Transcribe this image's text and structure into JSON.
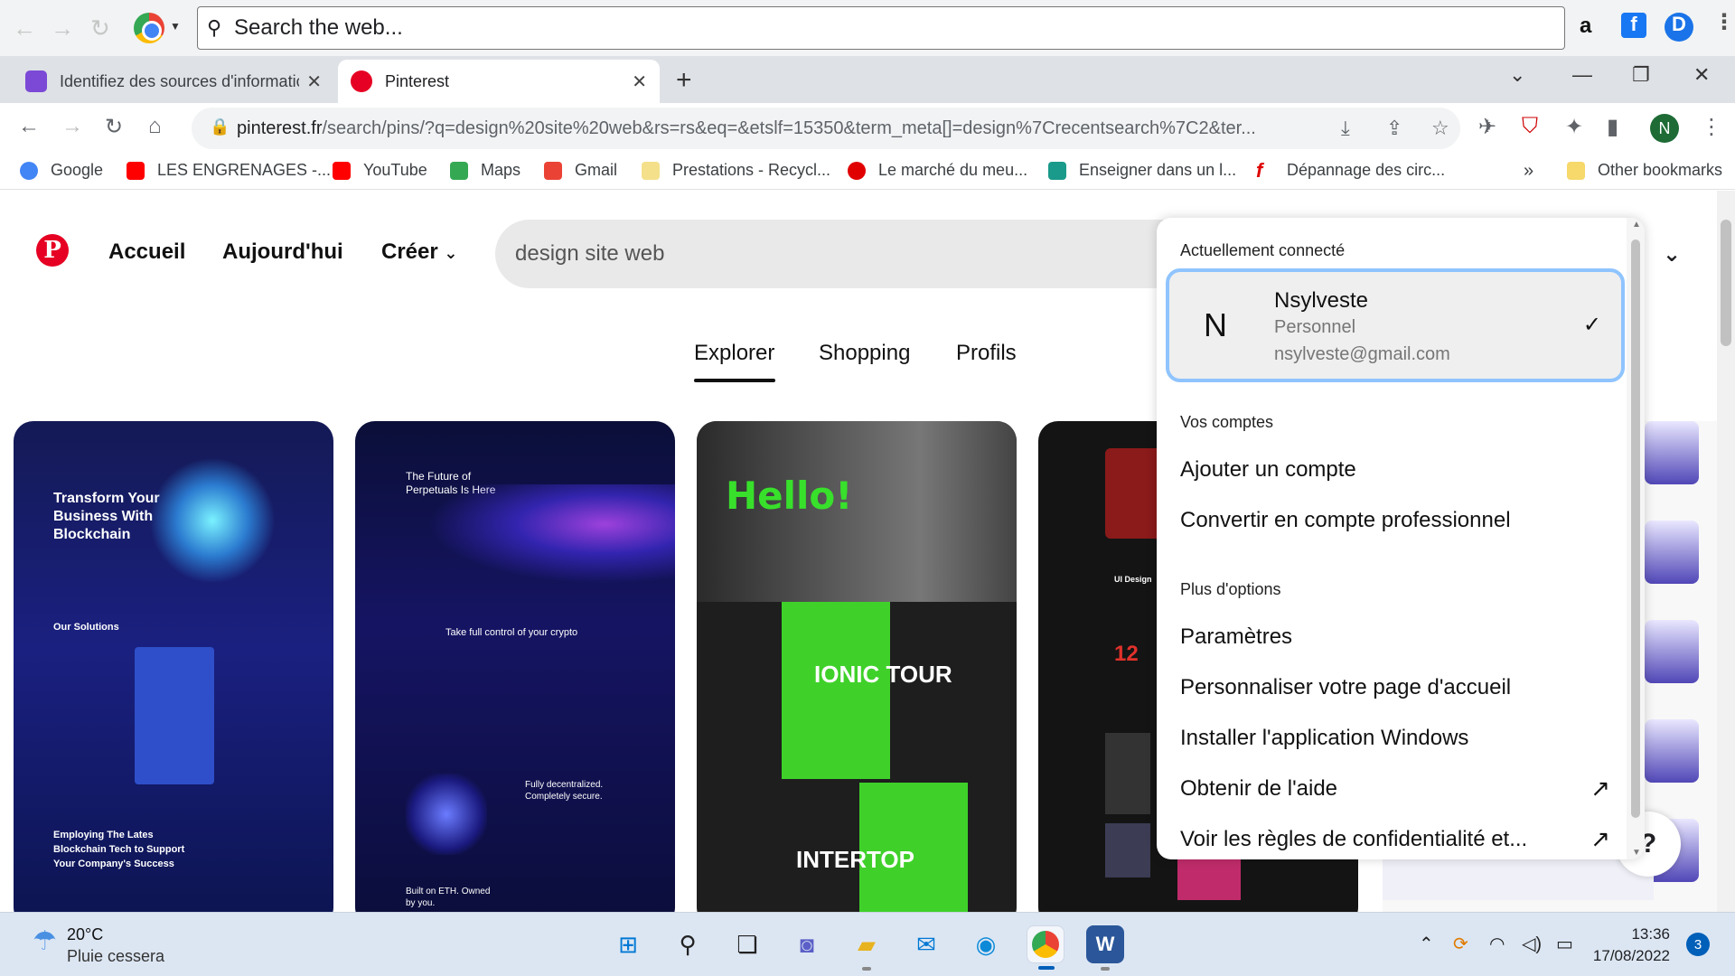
{
  "outer_search": {
    "placeholder": "Search the web..."
  },
  "tabs": [
    {
      "title": "Identifiez des sources d'information",
      "favicon_color": "#7b49d6"
    },
    {
      "title": "Pinterest",
      "favicon_color": "#e60023"
    }
  ],
  "omnibox": {
    "domain": "pinterest.fr",
    "path": "/search/pins/?q=design%20site%20web&rs=rs&eq=&etslf=15350&term_meta[]=design%7Crecentsearch%7C2&ter..."
  },
  "profile_initial": "N",
  "bookmarks": [
    {
      "label": "Google",
      "icon": "google-icon",
      "color": "#4285f4"
    },
    {
      "label": "LES ENGRENAGES -...",
      "icon": "youtube-icon",
      "color": "#ff0000"
    },
    {
      "label": "YouTube",
      "icon": "youtube-icon",
      "color": "#ff0000"
    },
    {
      "label": "Maps",
      "icon": "maps-icon",
      "color": "#34a853"
    },
    {
      "label": "Gmail",
      "icon": "gmail-icon",
      "color": "#ea4335"
    },
    {
      "label": "Prestations - Recycl...",
      "icon": "page-icon",
      "color": "#f4e08a"
    },
    {
      "label": "Le marché du meu...",
      "icon": "circle-icon",
      "color": "#e00000"
    },
    {
      "label": "Enseigner dans un l...",
      "icon": "site-icon",
      "color": "#1a9a8a"
    },
    {
      "label": "Dépannage des circ...",
      "icon": "f-icon",
      "color": "#e00000"
    }
  ],
  "bookmarks_more": "»",
  "other_bookmarks": "Other bookmarks",
  "pinterest": {
    "nav": {
      "home": "Accueil",
      "today": "Aujourd'hui",
      "create": "Créer"
    },
    "search_value": "design site web",
    "tabs": [
      "Explorer",
      "Shopping",
      "Profils"
    ],
    "cards": [
      {
        "headline": "Transform Your Business With Blockchain",
        "sub1": "Our Solutions",
        "sub2": "Employing The Lates Blockchain Tech to Support Your Company's Success"
      },
      {
        "headline": "The Future of Perpetuals Is Here",
        "sub1": "Take full control of your crypto",
        "sub2": "Fully decentralized. Completely secure.",
        "sub3": "Built on ETH. Owned by you."
      },
      {
        "headline": "Hello!",
        "sub1": "IONIC TOUR",
        "sub2": "INTERTOP"
      },
      {
        "headline": "12",
        "sub1": "UI Design"
      }
    ]
  },
  "account_menu": {
    "connected_label": "Actuellement connecté",
    "account": {
      "initial": "N",
      "name": "Nsylveste",
      "type": "Personnel",
      "email": "nsylveste@gmail.com"
    },
    "your_accounts_label": "Vos comptes",
    "add_account": "Ajouter un compte",
    "convert_pro": "Convertir en compte professionnel",
    "more_options_label": "Plus d'options",
    "settings": "Paramètres",
    "customize_home": "Personnaliser votre page d'accueil",
    "install_app": "Installer l'application Windows",
    "get_help": "Obtenir de l'aide",
    "privacy": "Voir les règles de confidentialité et..."
  },
  "taskbar": {
    "weather_temp": "20°C",
    "weather_desc": "Pluie cessera",
    "time": "13:36",
    "date": "17/08/2022",
    "notifications": "3"
  }
}
